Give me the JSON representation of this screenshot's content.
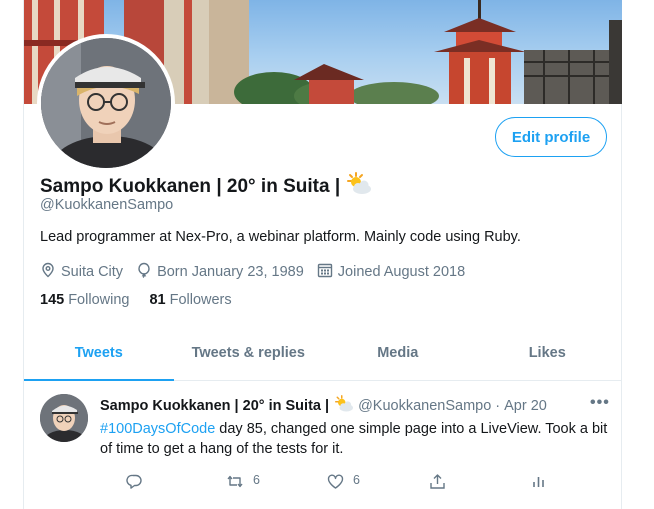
{
  "profile": {
    "name": "Sampo Kuokkanen | 20° in Suita |",
    "handle": "@KuokkanenSampo",
    "bio": "Lead programmer at Nex-Pro, a webinar platform. Mainly code using Ruby.",
    "location": "Suita City",
    "born": "Born January 23, 1989",
    "joined": "Joined August 2018",
    "following_count": "145",
    "following_label": "Following",
    "followers_count": "81",
    "followers_label": "Followers",
    "edit_label": "Edit profile",
    "weather_icon": "sun-behind-cloud-icon"
  },
  "tabs": [
    {
      "label": "Tweets",
      "active": true
    },
    {
      "label": "Tweets & replies",
      "active": false
    },
    {
      "label": "Media",
      "active": false
    },
    {
      "label": "Likes",
      "active": false
    }
  ],
  "tweet": {
    "name": "Sampo Kuokkanen | 20° in Suita |",
    "handle": "@KuokkanenSampo",
    "separator": "·",
    "date": "Apr 20",
    "hashtag": "#100DaysOfCode",
    "text": " day 85, changed one simple page into a LiveView. Took a bit of time to get a hang of the tests for it.",
    "more": "•••",
    "retweets": "6",
    "likes": "6"
  },
  "colors": {
    "accent": "#1da1f2",
    "secondary_text": "#657786",
    "border": "#e6ecf0"
  }
}
